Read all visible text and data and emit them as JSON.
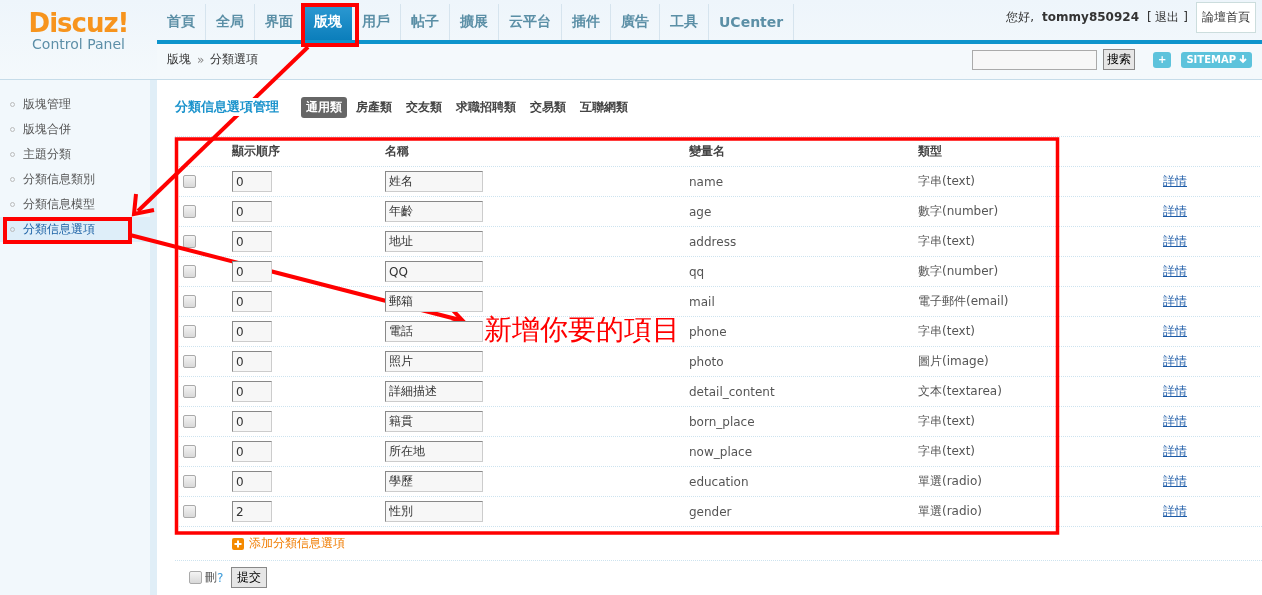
{
  "logo": {
    "brand": "Discuz!",
    "subtitle": "Control Panel"
  },
  "nav": [
    {
      "label": "首頁",
      "selected": false
    },
    {
      "label": "全局",
      "selected": false
    },
    {
      "label": "界面",
      "selected": false
    },
    {
      "label": "版塊",
      "selected": true
    },
    {
      "label": "用戶",
      "selected": false
    },
    {
      "label": "帖子",
      "selected": false
    },
    {
      "label": "擴展",
      "selected": false
    },
    {
      "label": "云平台",
      "selected": false
    },
    {
      "label": "插件",
      "selected": false
    },
    {
      "label": "廣告",
      "selected": false
    },
    {
      "label": "工具",
      "selected": false
    },
    {
      "label": "UCenter",
      "selected": false
    }
  ],
  "user": {
    "greeting": "您好,",
    "username": "tommy850924",
    "logout": "[ 退出 ]",
    "home_button": "論壇首頁"
  },
  "breadcrumb": {
    "items": [
      "版塊",
      "分類選項"
    ],
    "separator": "»"
  },
  "search": {
    "button": "搜索"
  },
  "plus_button": "+",
  "sitemap_button": "SITEMAP",
  "sidebar": {
    "items": [
      {
        "label": "版塊管理",
        "selected": false
      },
      {
        "label": "版塊合併",
        "selected": false
      },
      {
        "label": "主題分類",
        "selected": false
      },
      {
        "label": "分類信息類別",
        "selected": false
      },
      {
        "label": "分類信息模型",
        "selected": false
      },
      {
        "label": "分類信息選項",
        "selected": true
      }
    ]
  },
  "section_title": "分類信息選項管理",
  "type_tabs": [
    {
      "label": "通用類",
      "selected": true
    },
    {
      "label": "房產類",
      "selected": false
    },
    {
      "label": "交友類",
      "selected": false
    },
    {
      "label": "求職招聘類",
      "selected": false
    },
    {
      "label": "交易類",
      "selected": false
    },
    {
      "label": "互聯網類",
      "selected": false
    }
  ],
  "table": {
    "columns": [
      "顯示順序",
      "名稱",
      "變量名",
      "類型"
    ],
    "rows": [
      {
        "checked": false,
        "order": "0",
        "name": "姓名",
        "variable": "name",
        "type": "字串(text)",
        "link": "詳情"
      },
      {
        "checked": false,
        "order": "0",
        "name": "年齡",
        "variable": "age",
        "type": "數字(number)",
        "link": "詳情"
      },
      {
        "checked": false,
        "order": "0",
        "name": "地址",
        "variable": "address",
        "type": "字串(text)",
        "link": "詳情"
      },
      {
        "checked": false,
        "order": "0",
        "name": "QQ",
        "variable": "qq",
        "type": "數字(number)",
        "link": "詳情"
      },
      {
        "checked": false,
        "order": "0",
        "name": "郵箱",
        "variable": "mail",
        "type": "電子郵件(email)",
        "link": "詳情"
      },
      {
        "checked": false,
        "order": "0",
        "name": "電話",
        "variable": "phone",
        "type": "字串(text)",
        "link": "詳情"
      },
      {
        "checked": false,
        "order": "0",
        "name": "照片",
        "variable": "photo",
        "type": "圖片(image)",
        "link": "詳情"
      },
      {
        "checked": false,
        "order": "0",
        "name": "詳細描述",
        "variable": "detail_content",
        "type": "文本(textarea)",
        "link": "詳情"
      },
      {
        "checked": false,
        "order": "0",
        "name": "籍貫",
        "variable": "born_place",
        "type": "字串(text)",
        "link": "詳情"
      },
      {
        "checked": false,
        "order": "0",
        "name": "所在地",
        "variable": "now_place",
        "type": "字串(text)",
        "link": "詳情"
      },
      {
        "checked": false,
        "order": "0",
        "name": "學歷",
        "variable": "education",
        "type": "單選(radio)",
        "link": "詳情"
      },
      {
        "checked": false,
        "order": "2",
        "name": "性別",
        "variable": "gender",
        "type": "單選(radio)",
        "link": "詳情"
      }
    ]
  },
  "add_link": "添加分類信息選項",
  "footer": {
    "delete_checked": false,
    "delete_label": "刪",
    "help_mark": "?",
    "submit": "提交"
  },
  "annotation": {
    "text": "新增你要的項目"
  }
}
